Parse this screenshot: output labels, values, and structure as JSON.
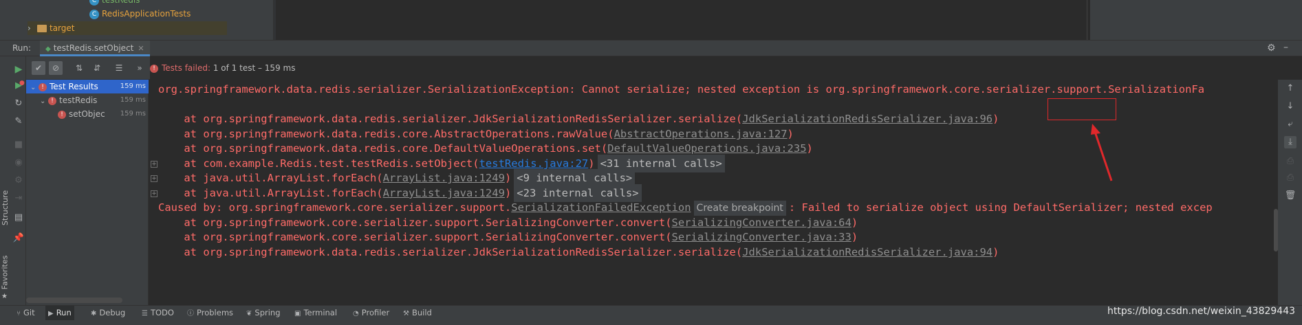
{
  "project_tree": {
    "test_redis_label": "testRedis",
    "redis_app_tests_label": "RedisApplicationTests",
    "target_label": "target"
  },
  "run_window": {
    "run_label": "Run:",
    "tab_label": "testRedis.setObject",
    "status_prefix": "Tests failed:",
    "status_count": "1",
    "status_suffix": "of 1 test – 159 ms"
  },
  "test_tree": {
    "nodes": [
      {
        "label": "Test Results",
        "time": "159 ms"
      },
      {
        "label": "testRedis",
        "time": "159 ms"
      },
      {
        "label": "setObjec",
        "time": "159 ms"
      }
    ]
  },
  "console": {
    "line1": "org.springframework.data.redis.serializer.SerializationException: Cannot serialize; nested exception is org.springframework.core.serializer.support.SerializationFa",
    "line2_pre": "    at org.springframework.data.redis.serializer.JdkSerializationRedisSerializer.serialize(",
    "line2_link": "JdkSerializationRedisSerializer.java:96",
    "line2_post": ")",
    "line3_pre": "    at org.springframework.data.redis.core.AbstractOperations.rawValue(",
    "line3_link": "AbstractOperations.java:127",
    "line3_post": ")",
    "line4_pre": "    at org.springframework.data.redis.core.DefaultValueOperations.set(",
    "line4_link": "DefaultValueOperations.java:235",
    "line4_post": ")",
    "line5_pre": "    at com.example.Redis.test.testRedis.setObject(",
    "line5_link": "testRedis.java:27",
    "line5_post": ")",
    "line5_internal": "<31 internal calls>",
    "line6_pre": "    at java.util.ArrayList.forEach(",
    "line6_link": "ArrayList.java:1249",
    "line6_post": ")",
    "line6_internal": "<9 internal calls>",
    "line7_pre": "    at java.util.ArrayList.forEach(",
    "line7_link": "ArrayList.java:1249",
    "line7_post": ")",
    "line7_internal": "<23 internal calls>",
    "line8_pre": "Caused by: org.springframework.core.serializer.support.",
    "line8_link": "SerializationFailedException",
    "line8_bp": "Create breakpoint",
    "line8_post": ": Failed to serialize object using DefaultSerializer; nested excep",
    "line9_pre": "    at org.springframework.core.serializer.support.SerializingConverter.convert(",
    "line9_link": "SerializingConverter.java:64",
    "line9_post": ")",
    "line10_pre": "    at org.springframework.core.serializer.support.SerializingConverter.convert(",
    "line10_link": "SerializingConverter.java:33",
    "line10_post": ")",
    "line11_pre": "    at org.springframework.data.redis.serializer.JdkSerializationRedisSerializer.serialize(",
    "line11_link": "JdkSerializationRedisSerializer.java:94",
    "line11_post": ")"
  },
  "bottom_bar": {
    "git": "Git",
    "run": "Run",
    "debug": "Debug",
    "todo": "TODO",
    "problems": "Problems",
    "spring": "Spring",
    "terminal": "Terminal",
    "profiler": "Profiler",
    "build": "Build"
  },
  "side_labels": {
    "structure": "Structure",
    "favorites": "Favorites"
  },
  "watermark": "https://blog.csdn.net/weixin_43829443",
  "colors": {
    "error_text": "#ff6b68",
    "link_blue": "#287bde",
    "selection": "#2f65ca",
    "annotation_red": "#e0282b"
  }
}
